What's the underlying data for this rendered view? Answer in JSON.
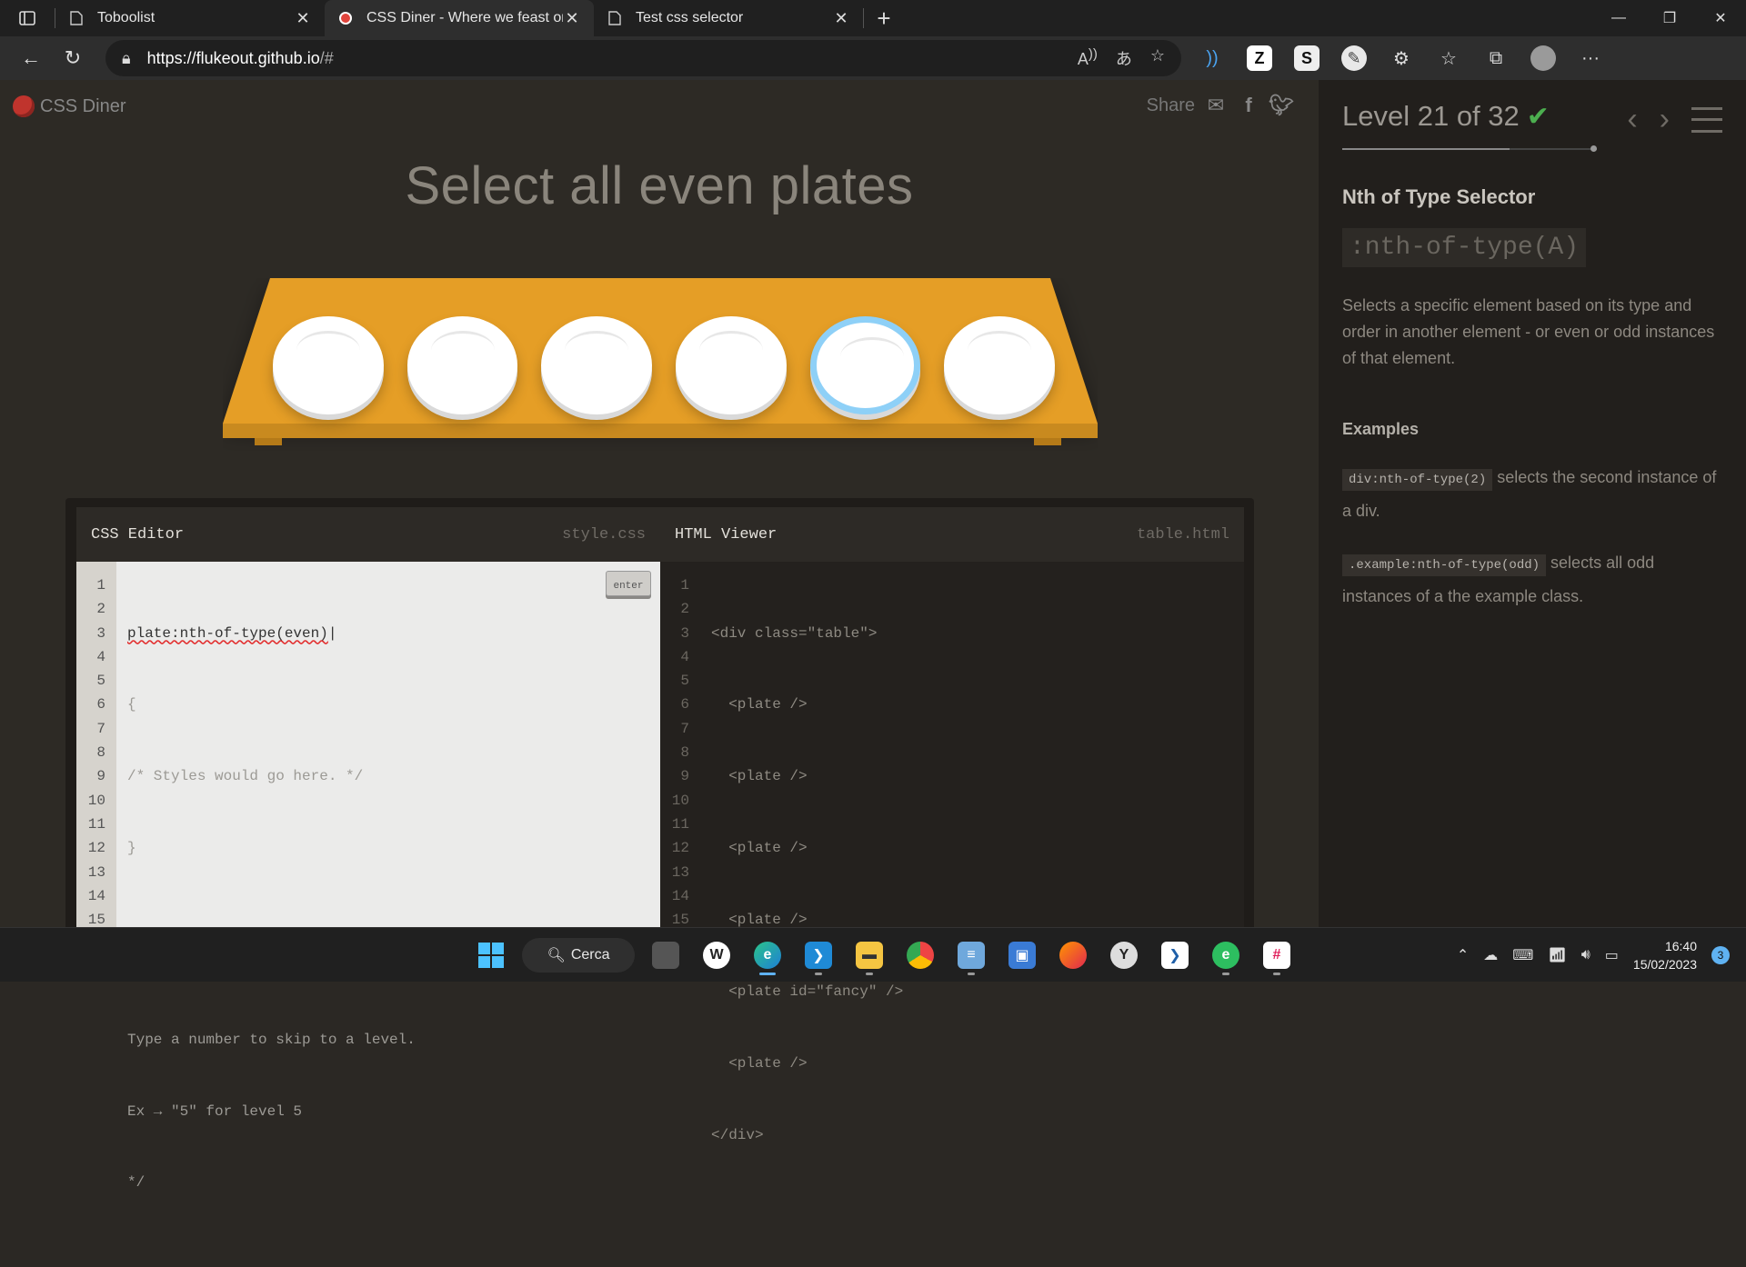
{
  "browser": {
    "tabs": [
      {
        "label": "Toboolist",
        "active": false
      },
      {
        "label": "CSS Diner - Where we feast on C",
        "active": true
      },
      {
        "label": "Test css selector",
        "active": false
      }
    ],
    "url_host": "https://flukeout.github.io",
    "url_rest": "/#"
  },
  "game": {
    "logo": "CSS Diner",
    "share_label": "Share",
    "order": "Select all even plates",
    "plates": [
      "plate",
      "plate",
      "plate",
      "plate",
      "fancy",
      "plate"
    ]
  },
  "css_editor": {
    "title": "CSS Editor",
    "file": "style.css",
    "input": "plate:nth-of-type(even)",
    "enter_label": "enter",
    "line_numbers": [
      "1",
      "2",
      "3",
      "4",
      "5",
      "6",
      "7",
      "8",
      "9",
      "10",
      "11",
      "12",
      "13",
      "14",
      "15"
    ],
    "lines": [
      "{",
      "/* Styles would go here. */",
      "}",
      "",
      "/*",
      "Type a number to skip to a level.",
      "Ex → \"5\" for level 5",
      "*/"
    ]
  },
  "html_viewer": {
    "title": "HTML Viewer",
    "file": "table.html",
    "line_numbers": [
      "1",
      "2",
      "3",
      "4",
      "5",
      "6",
      "7",
      "8",
      "9",
      "10",
      "11",
      "12",
      "13",
      "14",
      "15"
    ],
    "lines": [
      "<div class=\"table\">",
      "  <plate />",
      "  <plate />",
      "  <plate />",
      "  <plate />",
      "  <plate id=\"fancy\" />",
      "  <plate />",
      "</div>"
    ]
  },
  "sidebar": {
    "level": "Level 21 of 32",
    "level_progress": 0.656,
    "selector_name": "Nth of Type Selector",
    "syntax": ":nth-of-type(A)",
    "hint": "Selects a specific element based on its type and order in another element - or even or odd instances of that element.",
    "examples_title": "Examples",
    "examples": [
      {
        "code": "div:nth-of-type(2)",
        "text": " selects the second instance of a div."
      },
      {
        "code": ".example:nth-of-type(odd)",
        "text": " selects all odd instances of a the example class."
      }
    ]
  },
  "taskbar": {
    "search_label": "Cerca",
    "time": "16:40",
    "date": "15/02/2023",
    "notifications": "3"
  },
  "colors": {
    "accent": "#5fb2f2",
    "table": "#e59e28",
    "check": "#4cae4f"
  }
}
